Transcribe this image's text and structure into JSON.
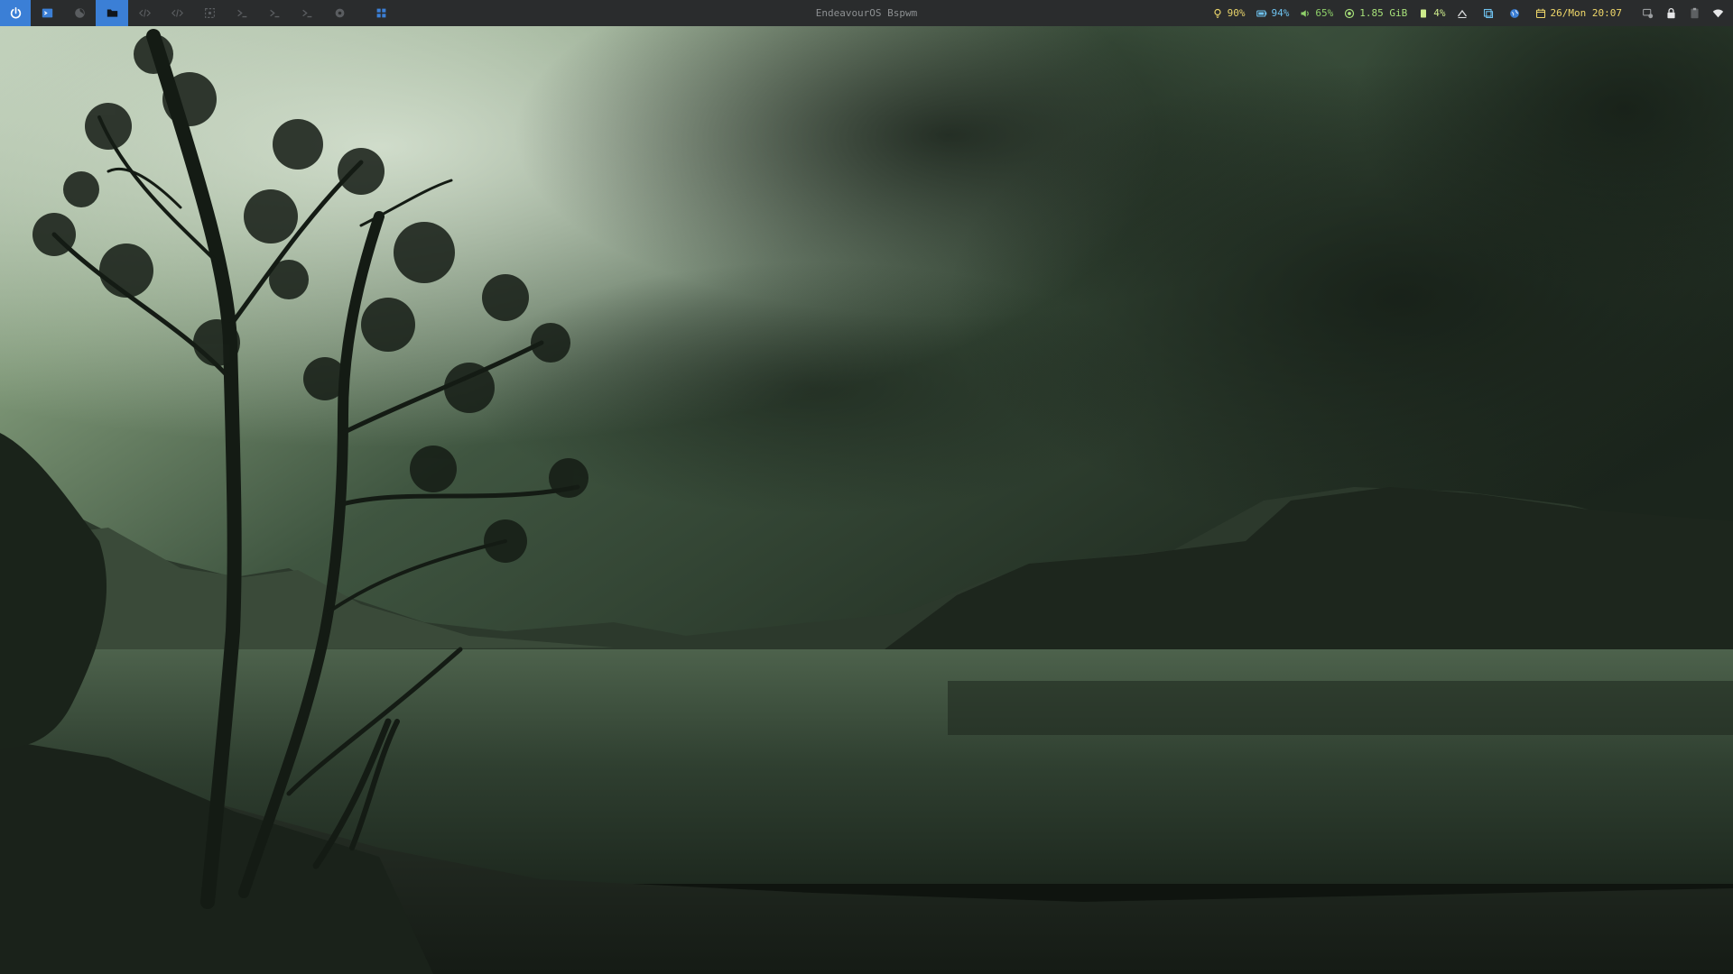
{
  "window_title": "EndeavourOS Bspwm",
  "colors": {
    "bar_bg": "#2a2c2d",
    "accent": "#3b7fd6",
    "brightness": "#e8d36a",
    "battery": "#6fc3f0",
    "volume": "#8fd16a",
    "memory": "#a7e07a",
    "cpu": "#cdeb8b",
    "date": "#f0d86a"
  },
  "workspaces": [
    {
      "icon": "power-icon",
      "active": true
    },
    {
      "icon": "terminal-window-icon",
      "active": false
    },
    {
      "icon": "firefox-icon",
      "active": false
    },
    {
      "icon": "folder-icon",
      "active": true
    },
    {
      "icon": "code-icon",
      "active": false
    },
    {
      "icon": "code-icon",
      "active": false
    },
    {
      "icon": "screenshot-icon",
      "active": false
    },
    {
      "icon": "terminal-prompt-icon",
      "active": false
    },
    {
      "icon": "terminal-prompt-icon",
      "active": false
    },
    {
      "icon": "terminal-prompt-icon",
      "active": false
    },
    {
      "icon": "settings-icon",
      "active": false
    },
    {
      "icon": "grid-icon",
      "active": false
    }
  ],
  "status": {
    "brightness": "90%",
    "battery": "94%",
    "volume": "65%",
    "memory": "1.85 GiB",
    "cpu": "4%",
    "date": "26/Mon 20:07"
  },
  "tray_icons": [
    "network-settings-icon",
    "lock-icon",
    "clipboard-icon",
    "wifi-icon"
  ]
}
